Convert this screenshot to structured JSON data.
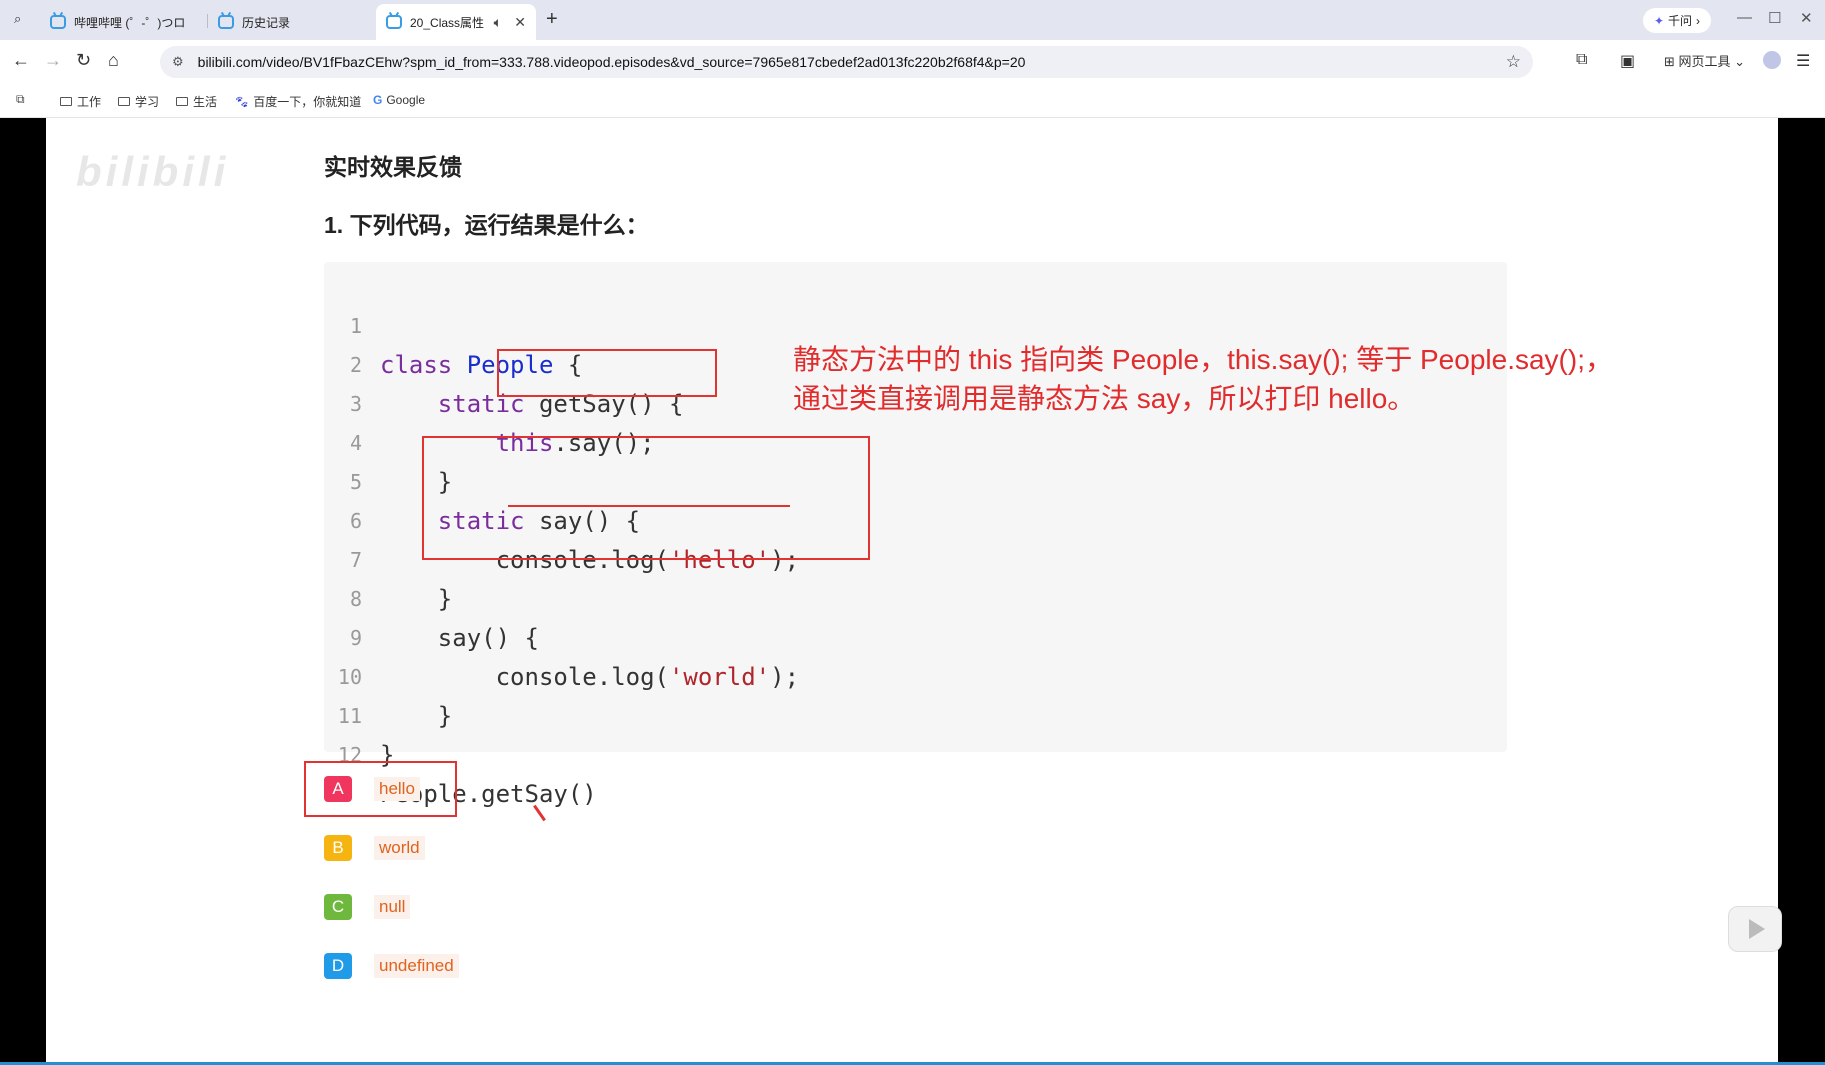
{
  "browser": {
    "tabs": [
      {
        "label": "哔哩哔哩 (゜-゜)つロ",
        "active": false
      },
      {
        "label": "历史记录",
        "active": false
      },
      {
        "label": "20_Class属性",
        "active": true
      }
    ],
    "qianwen_label": "千问",
    "url": "bilibili.com/video/BV1fFbazCEhw?spm_id_from=333.788.videopod.episodes&vd_source=7965e817cbedef2ad013fc220b2f68f4&p=20",
    "web_tools_label": "网页工具",
    "bookmarks": [
      "工作",
      "学习",
      "生活",
      "百度一下，你就知道",
      "Google"
    ]
  },
  "slide": {
    "watermark": "bilibili",
    "heading": "实时效果反馈",
    "question": "1. 下列代码，运行结果是什么：",
    "code_lines": [
      {
        "num": "1"
      },
      {
        "num": "2"
      },
      {
        "num": "3"
      },
      {
        "num": "4"
      },
      {
        "num": "5"
      },
      {
        "num": "6"
      },
      {
        "num": "7"
      },
      {
        "num": "8"
      },
      {
        "num": "9"
      },
      {
        "num": "10"
      },
      {
        "num": "11"
      },
      {
        "num": "12"
      }
    ],
    "code": {
      "l1_class": "class",
      "l1_name": "People",
      "l1_rest": " {",
      "l2_static": "static",
      "l2_rest": " getSay() {",
      "l3_this": "this",
      "l3_rest": ".say();",
      "l4": "}",
      "l5_static": "static",
      "l5_rest": " say() {",
      "l6_pre": "console.log(",
      "l6_str": "'hello'",
      "l6_post": ");",
      "l7": "}",
      "l8": "say() {",
      "l9_pre": "console.log(",
      "l9_str": "'world'",
      "l9_post": ");",
      "l10": "}",
      "l11": "}",
      "l12": "People.getSay()"
    },
    "annotation_line1": "静态方法中的 this 指向类 People，this.say(); 等于 People.say();，",
    "annotation_line2": "通过类直接调用是静态方法 say，所以打印 hello。",
    "options": [
      {
        "letter": "A",
        "text": "hello",
        "color": "#f0355e"
      },
      {
        "letter": "B",
        "text": "world",
        "color": "#f5b40f"
      },
      {
        "letter": "C",
        "text": "null",
        "color": "#6fb83e"
      },
      {
        "letter": "D",
        "text": "undefined",
        "color": "#1f9be8"
      }
    ]
  }
}
